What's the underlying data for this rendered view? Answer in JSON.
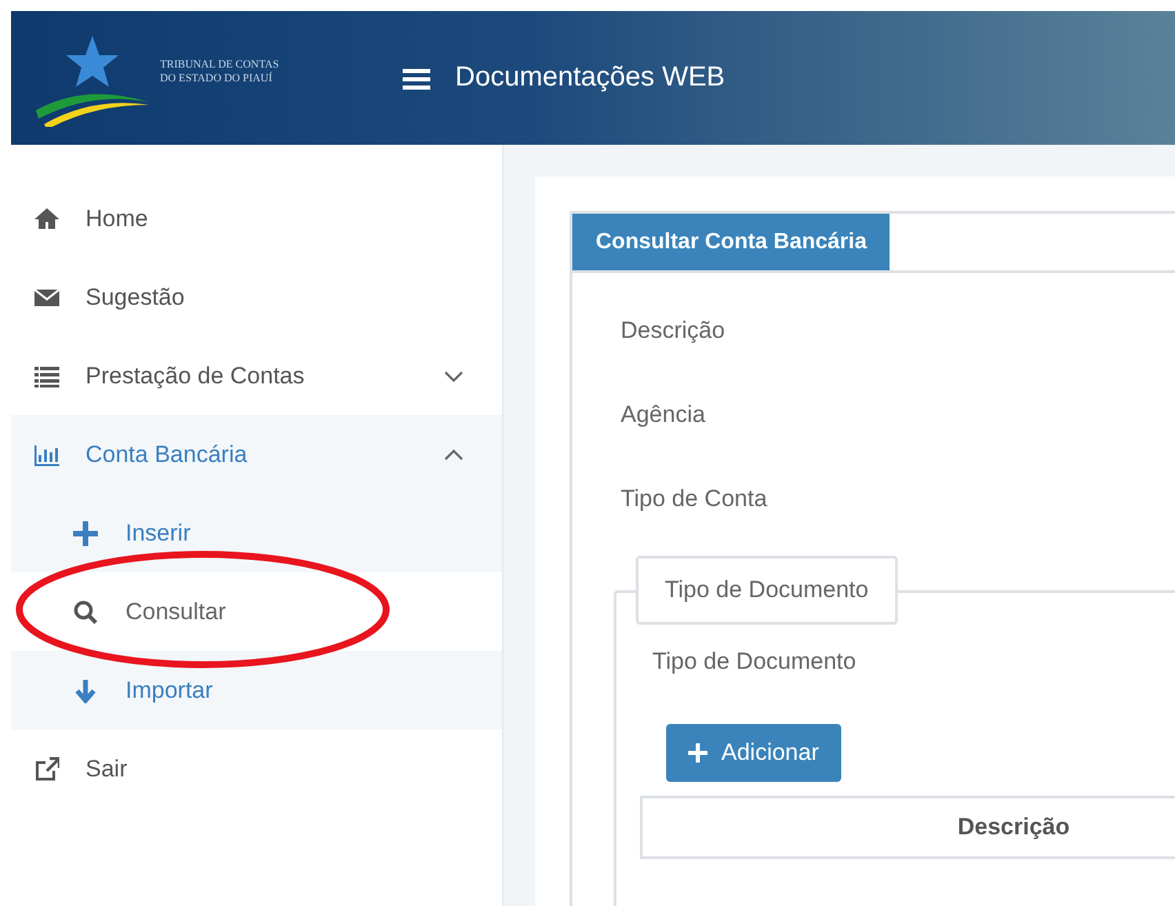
{
  "header": {
    "logo_lines": [
      "TRIBUNAL DE CONTAS",
      "DO ESTADO DO PIAUÍ"
    ],
    "title": "Documentações WEB"
  },
  "sidebar": {
    "items": [
      {
        "label": "Home",
        "selected": false
      },
      {
        "label": "Sugestão",
        "selected": false
      },
      {
        "label": "Prestação de Contas",
        "selected": false,
        "expanded": false
      },
      {
        "label": "Conta Bancária",
        "selected": true,
        "expanded": true,
        "children": [
          {
            "label": "Inserir",
            "selected": false
          },
          {
            "label": "Consultar",
            "selected": true
          },
          {
            "label": "Importar",
            "selected": false
          }
        ]
      },
      {
        "label": "Sair",
        "selected": false
      }
    ]
  },
  "content": {
    "tabs": [
      {
        "label": "Consultar Conta Bancária",
        "selected": true
      }
    ],
    "fields": [
      "Descrição",
      "Agência",
      "Tipo de Conta"
    ],
    "fieldset": {
      "legend": "Tipo de Documento",
      "field": "Tipo de Documento",
      "button": "Adicionar",
      "table": {
        "columns": [
          "Descrição"
        ]
      }
    }
  }
}
